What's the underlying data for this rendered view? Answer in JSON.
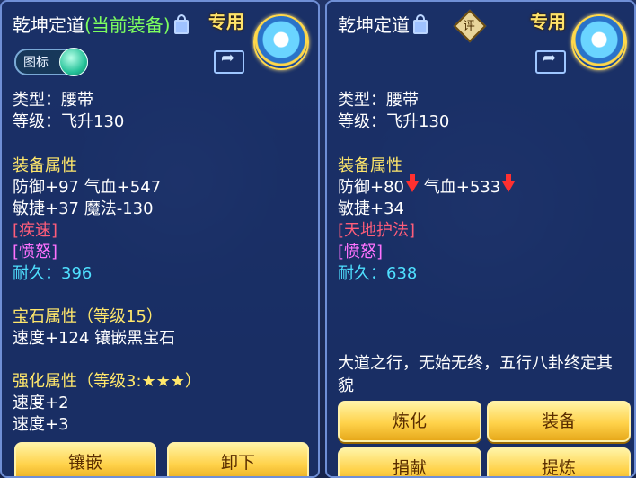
{
  "left": {
    "name": "乾坤定道",
    "equipped_tag": "(当前装备)",
    "special_tag": "专用",
    "icon_toggle_label": "图标",
    "type_line": "类型：腰带",
    "level_line": "等级：飞升130",
    "attr_header": "装备属性",
    "attr_line1": "防御+97 气血+547",
    "attr_line2": "敏捷+37 魔法-130",
    "special1": "[疾速]",
    "special2": "[愤怒]",
    "durability": "耐久：396",
    "gem_header": "宝石属性（等级15）",
    "gem_line": "速度+124 镶嵌黑宝石",
    "enhance_header": "强化属性（等级3:★★★）",
    "enhance_line1": "速度+2",
    "enhance_line2": "速度+3",
    "buttons": {
      "inlay": "镶嵌",
      "unequip": "卸下"
    }
  },
  "right": {
    "name": "乾坤定道",
    "rate_badge": "评",
    "special_tag": "专用",
    "type_line": "类型：腰带",
    "level_line": "等级：飞升130",
    "attr_header": "装备属性",
    "attr_def": "防御+80",
    "attr_hp": "气血+533",
    "attr_line2": "敏捷+34",
    "special1": "[天地护法]",
    "special2": "[愤怒]",
    "durability": "耐久：638",
    "description": "大道之行，无始无终，五行八卦终定其貌",
    "buttons": {
      "refine": "炼化",
      "equip": "装备",
      "donate": "捐献",
      "temper": "提炼"
    }
  },
  "icons": [
    "lock-icon",
    "share-icon",
    "emblem-icon",
    "down-arrow-icon"
  ],
  "colors": {
    "equipped": "#7dff5f",
    "section": "#ffe76b",
    "special": "#ff5d7a",
    "purple": "#ff72ff",
    "durability": "#4fe0ff",
    "button": "#ffd24a"
  }
}
